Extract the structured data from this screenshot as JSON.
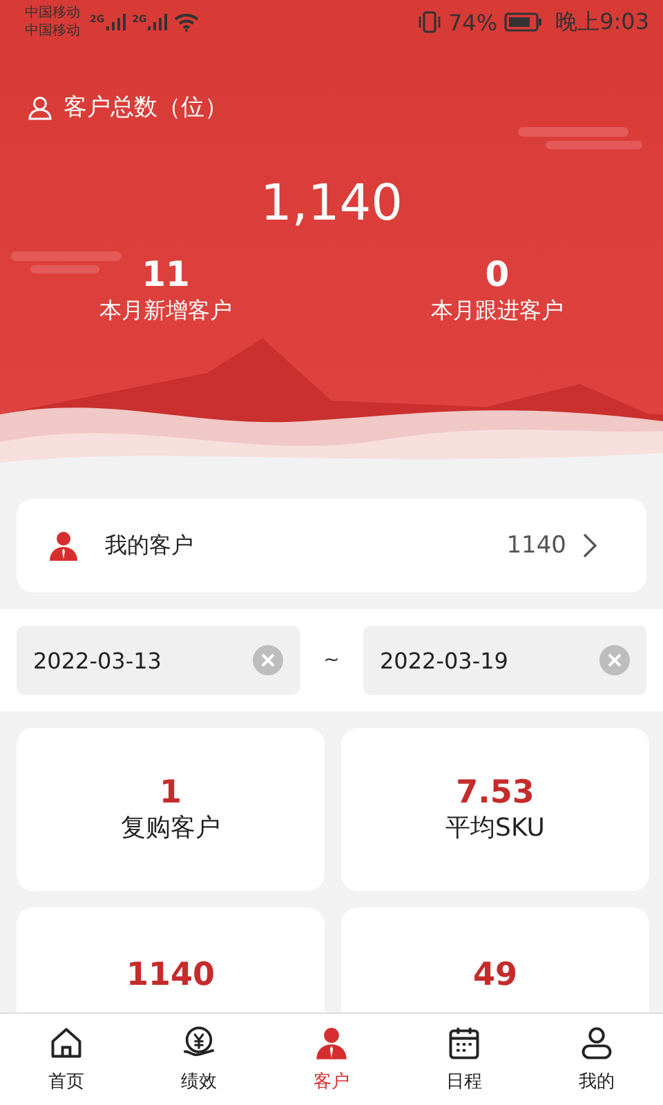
{
  "status_bar": {
    "carriers": [
      "中国移动",
      "中国移动"
    ],
    "networks": [
      "2G",
      "2G"
    ],
    "battery_text": "74%",
    "time": "晚上9:03"
  },
  "header": {
    "title": "客户总数（位）",
    "total": "1,140",
    "stats": [
      {
        "value": "11",
        "label": "本月新增客户"
      },
      {
        "value": "0",
        "label": "本月跟进客户"
      }
    ]
  },
  "my_customers": {
    "label": "我的客户",
    "count": "1140"
  },
  "date_range": {
    "start": "2022-03-13",
    "separator": "~",
    "end": "2022-03-19"
  },
  "cards": [
    {
      "value": "1",
      "label": "复购客户"
    },
    {
      "value": "7.53",
      "label": "平均SKU"
    },
    {
      "value": "1140"
    },
    {
      "value": "49"
    }
  ],
  "tabs": [
    {
      "label": "首页",
      "kind": "home",
      "selected": false
    },
    {
      "label": "绩效",
      "kind": "money",
      "selected": false
    },
    {
      "label": "客户",
      "kind": "customer",
      "selected": true
    },
    {
      "label": "日程",
      "kind": "calendar",
      "selected": false
    },
    {
      "label": "我的",
      "kind": "user",
      "selected": false
    }
  ]
}
